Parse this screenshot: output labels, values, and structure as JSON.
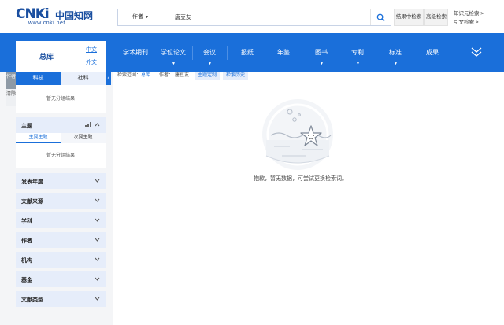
{
  "header": {
    "logo": {
      "brand_mark": "CNKi",
      "brand_cn": "中国知网",
      "url": "www.cnki.net"
    },
    "search": {
      "field_label": "作者",
      "query": "唐豆友",
      "search_icon": "search-icon"
    },
    "buttons": {
      "result_search": "结果中检索",
      "advanced_search": "高级检索"
    },
    "links": {
      "knowledge_search": "知识元检索 >",
      "citation_search": "引文检索 >"
    }
  },
  "nav": {
    "items": [
      {
        "label": "学术期刊",
        "has_arrow": false
      },
      {
        "label": "学位论文",
        "has_arrow": true
      },
      {
        "label": "会议",
        "has_arrow": true
      },
      {
        "label": "报纸",
        "has_arrow": false
      },
      {
        "label": "年鉴",
        "has_arrow": false
      },
      {
        "label": "图书",
        "has_arrow": true
      },
      {
        "label": "专利",
        "has_arrow": true
      },
      {
        "label": "标准",
        "has_arrow": true
      },
      {
        "label": "成果",
        "has_arrow": false
      }
    ],
    "expand_icon": "double-chevron-down-icon"
  },
  "sidebar": {
    "library": {
      "title": "总库",
      "lang_cn": "中文",
      "lang_foreign": "外文"
    },
    "side_toggle": {
      "first": "作者",
      "second": "清除"
    },
    "tabs": {
      "active": "科技",
      "inactive": "社科"
    },
    "no_result": "暂无分组结果",
    "topic_facet": {
      "label": "主题",
      "subtab_main": "主要主题",
      "subtab_secondary": "次要主题",
      "no_result": "暂无分组结果"
    },
    "facets": [
      {
        "label": "发表年度"
      },
      {
        "label": "文献来源"
      },
      {
        "label": "学科"
      },
      {
        "label": "作者"
      },
      {
        "label": "机构"
      },
      {
        "label": "基金"
      },
      {
        "label": "文献类型"
      }
    ]
  },
  "main": {
    "crumbs": {
      "range_label": "检索范围：",
      "range_value": "总库",
      "author_label": "作者：",
      "author_value": "唐豆友",
      "topic_custom": "主题定制",
      "search_history": "检索历史"
    },
    "empty": {
      "message": "抱歉，暂无数据，可尝试更换检索词。",
      "illustration": "empty-starfish-illustration"
    }
  },
  "colors": {
    "brand_blue": "#1a6fda",
    "logo_blue": "#1a4fa0",
    "facet_bg": "#e6edfa"
  }
}
